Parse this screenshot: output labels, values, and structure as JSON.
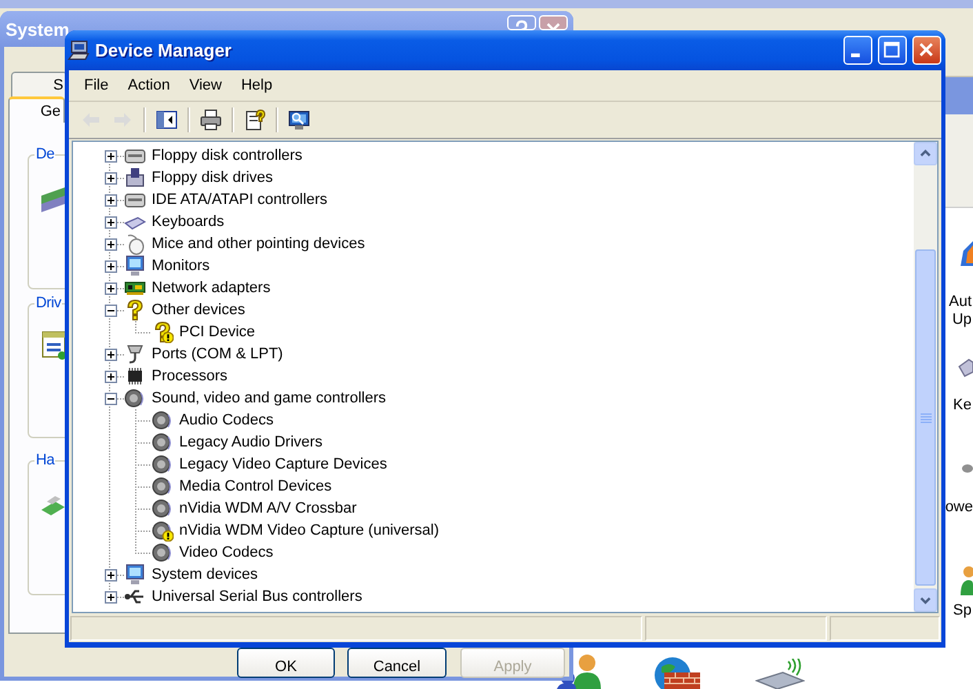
{
  "control_panel": {
    "labels": [
      "Aut",
      "Up",
      "Ke",
      "owe",
      "Sp"
    ]
  },
  "system_properties": {
    "title": "System",
    "tabs": [
      {
        "label": "S",
        "selected": false
      },
      {
        "label": "Ge",
        "selected": true
      }
    ],
    "groups": [
      "De",
      "Driv",
      "Ha"
    ],
    "buttons": [
      {
        "label": "OK",
        "disabled": false
      },
      {
        "label": "Cancel",
        "disabled": false
      },
      {
        "label": "Apply",
        "disabled": true
      }
    ]
  },
  "device_manager": {
    "title": "Device Manager",
    "menu": [
      "File",
      "Action",
      "View",
      "Help"
    ],
    "toolbar": [
      {
        "kind": "back",
        "disabled": true
      },
      {
        "kind": "forward",
        "disabled": true
      },
      {
        "kind": "console-tree",
        "disabled": false
      },
      {
        "kind": "print",
        "disabled": false
      },
      {
        "kind": "properties",
        "disabled": false
      },
      {
        "kind": "scan",
        "disabled": false
      }
    ],
    "tree": [
      {
        "label": "Floppy disk controllers",
        "expanded": false,
        "problem": false
      },
      {
        "label": "Floppy disk drives",
        "expanded": false,
        "problem": false
      },
      {
        "label": "IDE ATA/ATAPI controllers",
        "expanded": false,
        "problem": false
      },
      {
        "label": "Keyboards",
        "expanded": false,
        "problem": false
      },
      {
        "label": "Mice and other pointing devices",
        "expanded": false,
        "problem": false
      },
      {
        "label": "Monitors",
        "expanded": false,
        "problem": false
      },
      {
        "label": "Network adapters",
        "expanded": false,
        "problem": false
      },
      {
        "label": "Other devices",
        "expanded": true,
        "problem": false,
        "children": [
          {
            "label": "PCI Device",
            "problem": true
          }
        ]
      },
      {
        "label": "Ports (COM & LPT)",
        "expanded": false,
        "problem": false
      },
      {
        "label": "Processors",
        "expanded": false,
        "problem": false
      },
      {
        "label": "Sound, video and game controllers",
        "expanded": true,
        "problem": false,
        "children": [
          {
            "label": "Audio Codecs",
            "problem": false
          },
          {
            "label": "Legacy Audio Drivers",
            "problem": false
          },
          {
            "label": "Legacy Video Capture Devices",
            "problem": false
          },
          {
            "label": "Media Control Devices",
            "problem": false
          },
          {
            "label": "nVidia WDM A/V Crossbar",
            "problem": false
          },
          {
            "label": "nVidia WDM Video Capture (universal)",
            "problem": true
          },
          {
            "label": "Video Codecs",
            "problem": false
          }
        ]
      },
      {
        "label": "System devices",
        "expanded": false,
        "problem": false
      },
      {
        "label": "Universal Serial Bus controllers",
        "expanded": false,
        "problem": false
      }
    ]
  }
}
